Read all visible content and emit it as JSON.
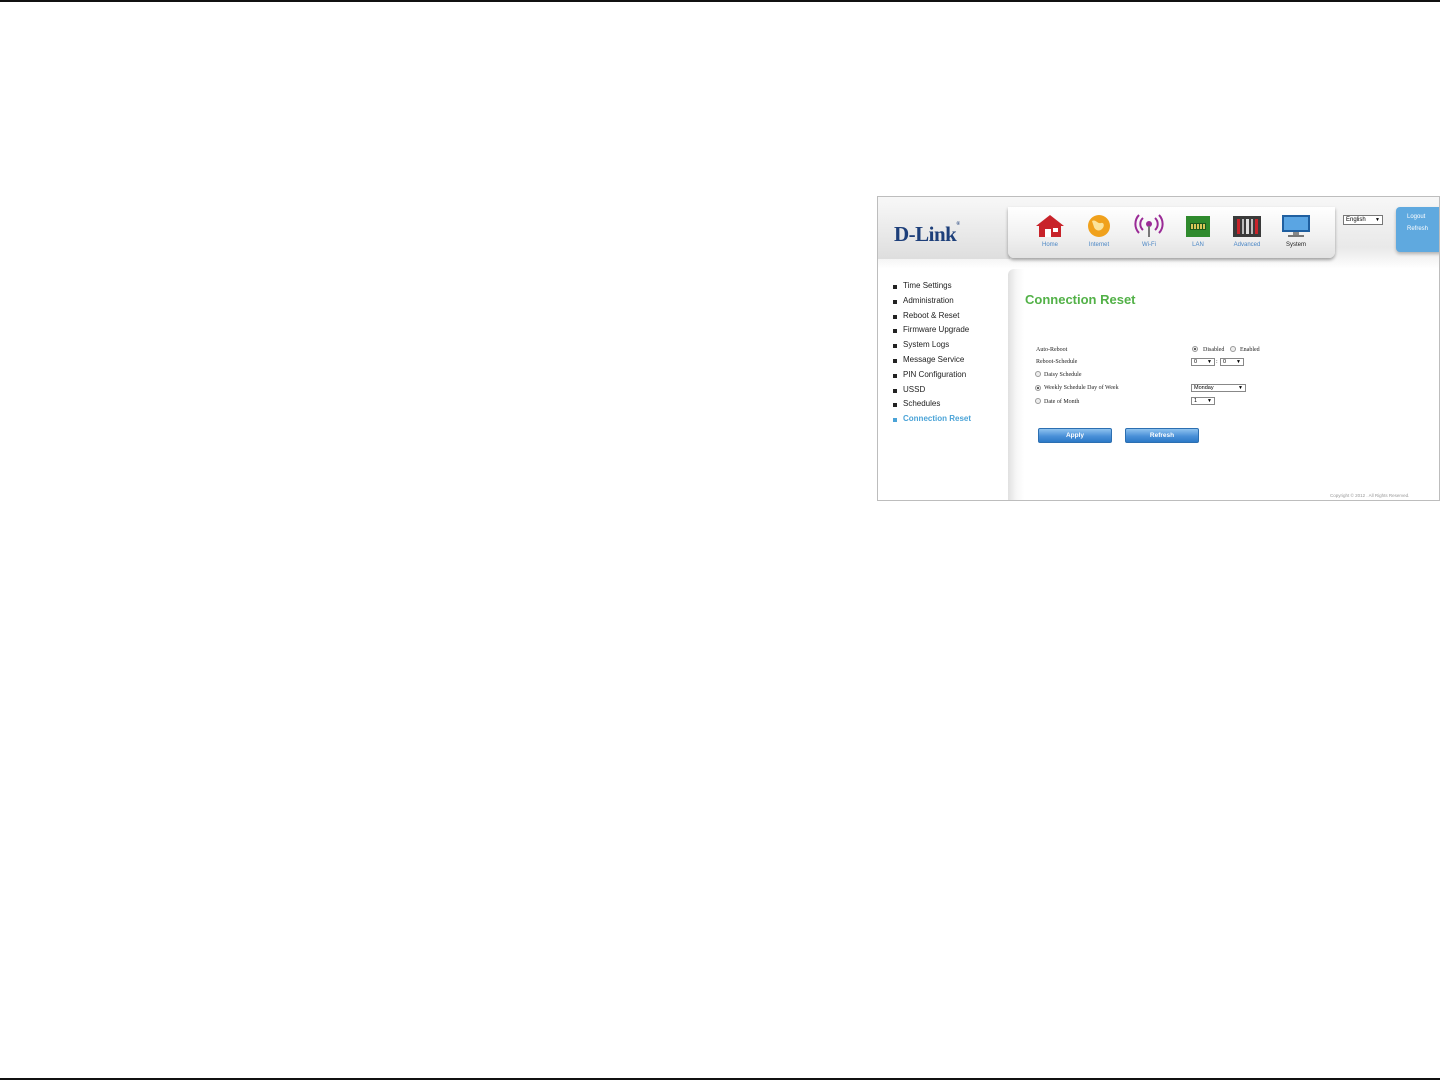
{
  "brand": {
    "logo_text": "D-Link",
    "logo_mark": "®"
  },
  "nav": {
    "items": [
      {
        "label": "Home",
        "icon": "home-icon",
        "active": false
      },
      {
        "label": "Internet",
        "icon": "globe-icon",
        "active": false
      },
      {
        "label": "Wi-Fi",
        "icon": "wifi-icon",
        "active": false
      },
      {
        "label": "LAN",
        "icon": "lan-icon",
        "active": false
      },
      {
        "label": "Advanced",
        "icon": "tools-icon",
        "active": false
      },
      {
        "label": "System",
        "icon": "monitor-icon",
        "active": true
      }
    ]
  },
  "language": {
    "selected": "English"
  },
  "account": {
    "logout_label": "Logout",
    "refresh_label": "Refresh"
  },
  "sidebar": {
    "items": [
      {
        "label": "Time Settings"
      },
      {
        "label": "Administration"
      },
      {
        "label": "Reboot & Reset"
      },
      {
        "label": "Firmware Upgrade"
      },
      {
        "label": "System Logs"
      },
      {
        "label": "Message Service"
      },
      {
        "label": "PIN Configuration"
      },
      {
        "label": "USSD"
      },
      {
        "label": "Schedules"
      },
      {
        "label": "Connection Reset",
        "active": true
      }
    ]
  },
  "page": {
    "title": "Connection Reset"
  },
  "form": {
    "auto_reboot_label": "Auto-Reboot",
    "disabled_label": "Disabled",
    "enabled_label": "Enabled",
    "auto_reboot_value": "Disabled",
    "reboot_schedule_label": "Reboot-Schedule",
    "hour_value": "0",
    "minute_value": "0",
    "time_separator": ":",
    "daily_label": "Daisy Schedule",
    "weekly_label": "Weekly Schedule Day of Week",
    "weekday_value": "Monday",
    "monthly_label": "Date of Month",
    "month_date_value": "1",
    "schedule_choice": "Weekly Schedule Day of Week"
  },
  "actions": {
    "apply_label": "Apply",
    "refresh_label": "Refresh"
  },
  "footer": {
    "copyright": "Copyright © 2012 . All Rights Reserved."
  },
  "colors": {
    "title_green": "#52b147",
    "accent_blue": "#4aa3d7",
    "button_blue": "#3d87d2",
    "logo_navy": "#1d3f7a"
  }
}
